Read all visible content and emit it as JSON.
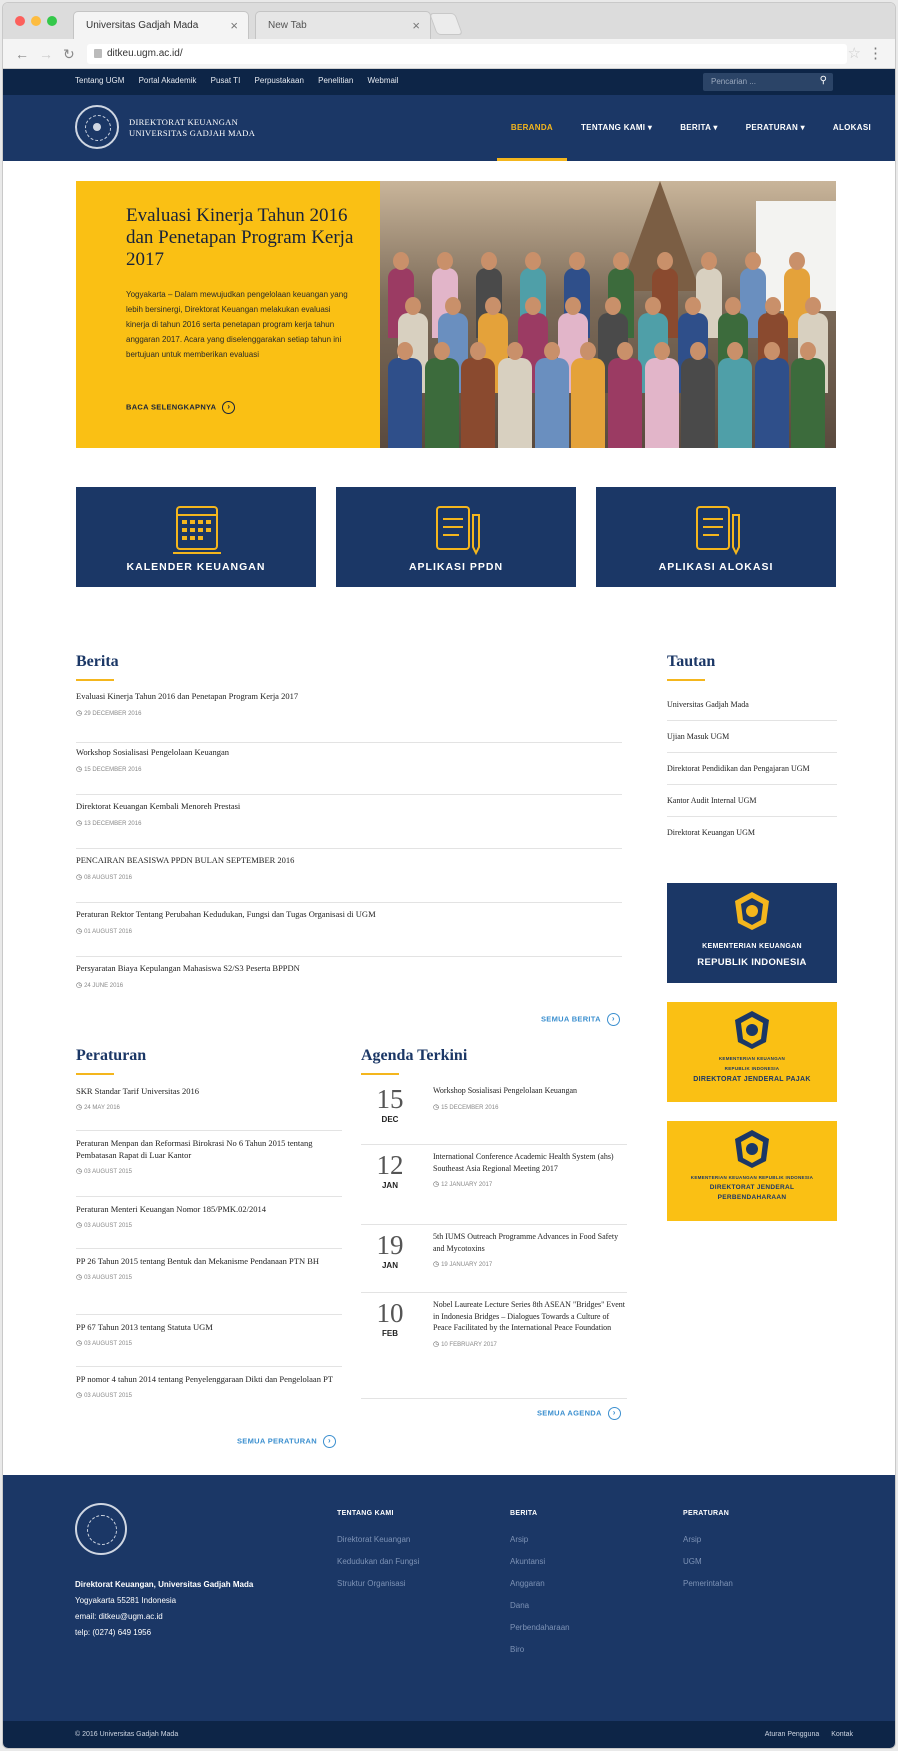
{
  "browser": {
    "tabs": [
      {
        "label": "Universitas Gadjah Mada"
      },
      {
        "label": "New Tab"
      }
    ],
    "url": "ditkeu.ugm.ac.id/"
  },
  "topbar": {
    "links": [
      "Tentang UGM",
      "Portal Akademik",
      "Pusat TI",
      "Perpustakaan",
      "Penelitian",
      "Webmail"
    ],
    "search_placeholder": "Pencarian ..."
  },
  "header": {
    "brand_line1": "DIREKTORAT KEUANGAN",
    "brand_line2": "UNIVERSITAS GADJAH MADA",
    "nav": [
      {
        "label": "BERANDA"
      },
      {
        "label": "TENTANG KAMI ▾"
      },
      {
        "label": "BERITA ▾"
      },
      {
        "label": "PERATURAN ▾"
      },
      {
        "label": "ALOKASI"
      }
    ]
  },
  "hero": {
    "title": "Evaluasi Kinerja Tahun 2016 dan Penetapan Program Kerja 2017",
    "body": "Yogyakarta – Dalam mewujudkan pengelolaan keuangan yang lebih bersinergi, Direktorat Keuangan melakukan evaluasi kinerja di tahun 2016 serta penetapan program kerja tahun anggaran 2017. Acara yang diselenggarakan setiap tahun ini bertujuan untuk memberikan evaluasi",
    "cta": "BACA SELENGKAPNYA"
  },
  "tiles": [
    {
      "label": "KALENDER KEUANGAN"
    },
    {
      "label": "APLIKASI PPDN"
    },
    {
      "label": "APLIKASI ALOKASI"
    }
  ],
  "berita": {
    "title": "Berita",
    "items": [
      {
        "title": "Evaluasi Kinerja Tahun 2016 dan Penetapan Program Kerja 2017",
        "date": "29 DECEMBER 2016"
      },
      {
        "title": "Workshop Sosialisasi Pengelolaan Keuangan",
        "date": "15 DECEMBER 2016"
      },
      {
        "title": "Direktorat Keuangan Kembali Menoreh Prestasi",
        "date": "13 DECEMBER 2016"
      },
      {
        "title": "PENCAIRAN BEASISWA PPDN BULAN SEPTEMBER 2016",
        "date": "08 AUGUST 2016"
      },
      {
        "title": "Peraturan Rektor Tentang Perubahan Kedudukan, Fungsi dan Tugas Organisasi di UGM",
        "date": "01 AUGUST 2016"
      },
      {
        "title": "Persyaratan Biaya Kepulangan Mahasiswa S2/S3 Peserta BPPDN",
        "date": "24 JUNE 2016"
      }
    ],
    "all": "SEMUA BERITA"
  },
  "tautan": {
    "title": "Tautan",
    "links": [
      "Universitas Gadjah Mada",
      "Ujian Masuk UGM",
      "Direktorat Pendidikan dan Pengajaran UGM",
      "Kantor Audit Internal UGM",
      "Direktorat Keuangan UGM"
    ],
    "badges": [
      {
        "l1": "KEMENTERIAN KEUANGAN",
        "l2": "REPUBLIK INDONESIA"
      },
      {
        "l1": "KEMENTERIAN KEUANGAN",
        "l2": "REPUBLIK INDONESIA",
        "l3": "DIREKTORAT JENDERAL PAJAK"
      },
      {
        "l1": "KEMENTERIAN KEUANGAN REPUBLIK INDONESIA",
        "l2": "DIREKTORAT JENDERAL",
        "l3": "PERBENDAHARAAN"
      }
    ]
  },
  "peraturan": {
    "title": "Peraturan",
    "items": [
      {
        "title": "SKR Standar Tarif Universitas 2016",
        "date": "24 MAY 2016"
      },
      {
        "title": "Peraturan Menpan dan Reformasi Birokrasi No 6 Tahun 2015 tentang Pembatasan Rapat di Luar Kantor",
        "date": "03 AUGUST 2015"
      },
      {
        "title": "Peraturan Menteri Keuangan Nomor 185/PMK.02/2014",
        "date": "03 AUGUST 2015"
      },
      {
        "title": "PP 26 Tahun 2015 tentang Bentuk dan Mekanisme Pendanaan PTN BH",
        "date": "03 AUGUST 2015"
      },
      {
        "title": "PP 67 Tahun 2013 tentang Statuta UGM",
        "date": "03 AUGUST 2015"
      },
      {
        "title": "PP nomor 4 tahun 2014 tentang Penyelenggaraan Dikti dan Pengelolaan PT",
        "date": "03 AUGUST 2015"
      }
    ],
    "all": "SEMUA PERATURAN"
  },
  "agenda": {
    "title": "Agenda Terkini",
    "items": [
      {
        "day": "15",
        "mon": "DEC",
        "title": "Workshop Sosialisasi Pengelolaan Keuangan",
        "date": "15 DECEMBER 2016"
      },
      {
        "day": "12",
        "mon": "JAN",
        "title": "International Conference Academic Health System (ahs) Southeast Asia Regional Meeting 2017",
        "date": "12 JANUARY 2017"
      },
      {
        "day": "19",
        "mon": "JAN",
        "title": "5th IUMS Outreach Programme Advances in Food Safety and Mycotoxins",
        "date": "19 JANUARY 2017"
      },
      {
        "day": "10",
        "mon": "FEB",
        "title": "Nobel Laureate Lecture Series 8th ASEAN \"Bridges\" Event in Indonesia Bridges – Dialogues Towards a Culture of Peace Facilitated by the International Peace Foundation",
        "date": "10 FEBRUARY 2017"
      }
    ],
    "all": "SEMUA AGENDA"
  },
  "footer": {
    "org": "Direktorat Keuangan, Universitas Gadjah Mada",
    "addr": "Yogyakarta 55281 Indonesia",
    "email": "email: ditkeu@ugm.ac.id",
    "telp": "telp: (0274) 649 1956",
    "cols": [
      {
        "head": "TENTANG KAMI",
        "items": [
          "Direktorat Keuangan",
          "Kedudukan dan Fungsi",
          "Struktur Organisasi"
        ]
      },
      {
        "head": "BERITA",
        "items": [
          "Arsip",
          "Akuntansi",
          "Anggaran",
          "Dana",
          "Perbendaharaan",
          "Biro"
        ]
      },
      {
        "head": "PERATURAN",
        "items": [
          "Arsip",
          "UGM",
          "Pemerintahan"
        ]
      }
    ],
    "copyright": "© 2016 Universitas Gadjah Mada",
    "bottom_links": [
      "Aturan Pengguna",
      "Kontak"
    ]
  },
  "colors": {
    "navy": "#1b3766",
    "dark_navy": "#0d2547",
    "gold": "#f4b61d",
    "yellow": "#fac014",
    "link_blue": "#3b8fcf"
  }
}
